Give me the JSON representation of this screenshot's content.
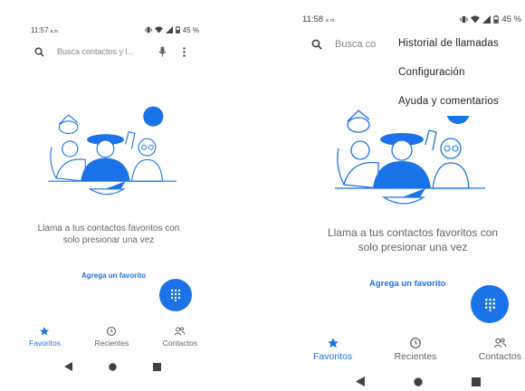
{
  "colors": {
    "accent": "#1a73e8",
    "text": "#3c4043",
    "muted": "#5f6368"
  },
  "left": {
    "status": {
      "time": "11:57",
      "ampm": "a.m.",
      "battery": "45 %"
    },
    "search": {
      "placeholder": "Busca contactos y l..."
    },
    "empty_message": "Llama a tus contactos favoritos con solo presionar una vez",
    "add_favorite": "Agrega un favorito",
    "nav": [
      "Favoritos",
      "Recientes",
      "Contactos"
    ]
  },
  "right": {
    "status": {
      "time": "11:58",
      "ampm": "a. m.",
      "battery": "45 %"
    },
    "search": {
      "placeholder": "Busca co"
    },
    "menu": [
      "Historial de llamadas",
      "Configuración",
      "Ayuda y comentarios"
    ],
    "empty_message": "Llama a tus contactos favoritos con solo presionar una vez",
    "add_favorite": "Agrega un favorito",
    "nav": [
      "Favoritos",
      "Recientes",
      "Contactos"
    ]
  },
  "icons": [
    "search-icon",
    "mic-icon",
    "more-vert-icon",
    "dialpad-icon",
    "star-icon",
    "clock-icon",
    "contacts-icon",
    "back-icon",
    "home-icon",
    "recents-icon"
  ]
}
